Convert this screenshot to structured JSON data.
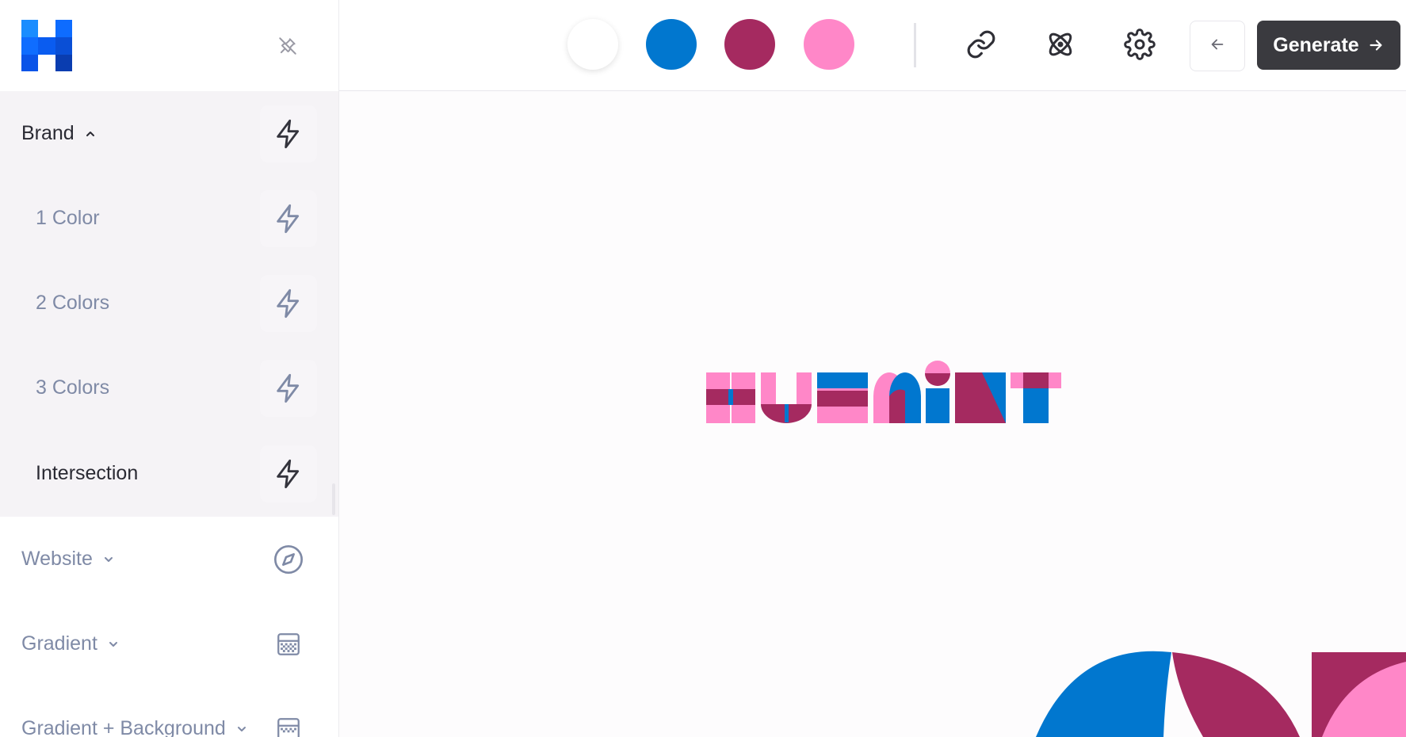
{
  "app": {
    "name": "Huemint"
  },
  "sidebar": {
    "pin_icon": "pin-off-icon",
    "items": [
      {
        "label": "Brand",
        "expanded": true,
        "icon": "lightning-icon",
        "level": 0
      },
      {
        "label": "1 Color",
        "icon": "lightning-icon",
        "level": 1
      },
      {
        "label": "2 Colors",
        "icon": "lightning-icon",
        "level": 1
      },
      {
        "label": "3 Colors",
        "icon": "lightning-icon",
        "level": 1
      },
      {
        "label": "Intersection",
        "icon": "lightning-icon",
        "level": 1,
        "selected": true
      },
      {
        "label": "Website",
        "expanded": false,
        "icon": "compass-icon",
        "level": 0
      },
      {
        "label": "Gradient",
        "expanded": false,
        "icon": "gradient-icon",
        "level": 0
      },
      {
        "label": "Gradient + Background",
        "expanded": false,
        "icon": "gradient-icon",
        "level": 0
      }
    ]
  },
  "palette": {
    "colors": [
      "#ffffff",
      "#0177cf",
      "#a52a60",
      "#ff87c8"
    ]
  },
  "toolbar": {
    "link_icon": "link-icon",
    "atom_icon": "atom-icon",
    "settings_icon": "gear-icon",
    "back_icon": "arrow-left-icon",
    "generate_label": "Generate",
    "generate_icon": "arrow-right-icon"
  },
  "preview": {
    "logo_text": "HUEMINT",
    "colors": {
      "blue": "#0177cf",
      "plum": "#a52a60",
      "pink": "#ff87c8"
    }
  }
}
